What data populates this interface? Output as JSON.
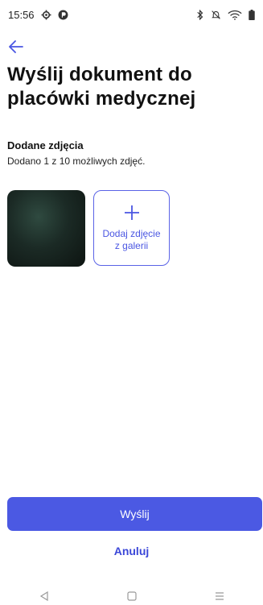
{
  "status_bar": {
    "time": "15:56",
    "left_icons": [
      "gear-icon",
      "app-notification-icon"
    ],
    "right_icons": [
      "bluetooth-icon",
      "mute-icon",
      "wifi-icon",
      "battery-icon"
    ]
  },
  "header": {
    "back_icon": "arrow-left-icon",
    "title": "Wyślij dokument do placówki medycznej"
  },
  "photos_section": {
    "title": "Dodane zdjęcia",
    "subtitle": "Dodano 1 z 10 możliwych zdjęć.",
    "add_button_label": "Dodaj zdjęcie z galerii"
  },
  "actions": {
    "send_label": "Wyślij",
    "cancel_label": "Anuluj"
  },
  "nav_bar": {
    "icons": [
      "back-triangle-icon",
      "home-square-icon",
      "menu-icon"
    ]
  },
  "colors": {
    "accent": "#4b59e3",
    "link": "#3b47d8"
  }
}
